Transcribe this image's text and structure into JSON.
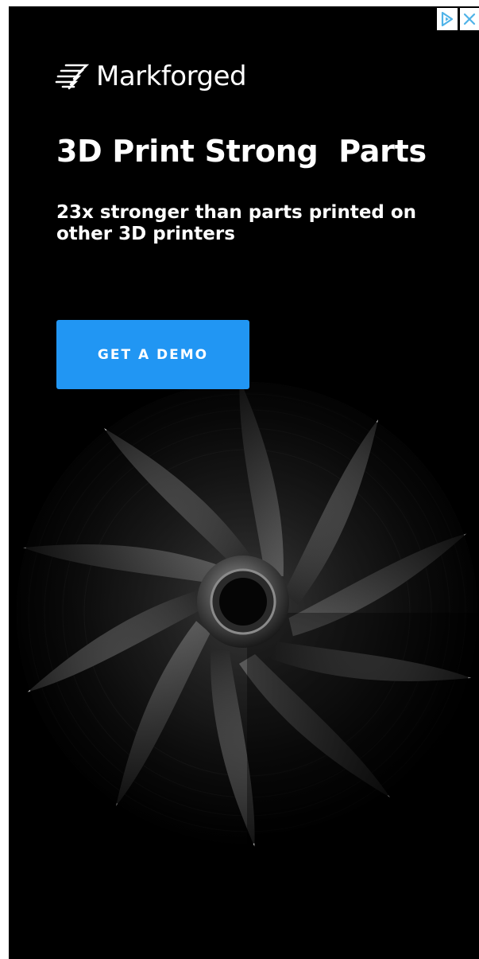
{
  "brand": {
    "name": "Markforged",
    "logo_icon": "markforged-stripes-icon"
  },
  "headline": "3D Print Strong  Parts",
  "subheadline": "23x stronger than parts printed on other 3D printers",
  "cta": {
    "label": "GET A DEMO"
  },
  "ad_controls": {
    "adchoices_icon": "adchoices-icon",
    "close_icon": "close-icon"
  },
  "colors": {
    "background": "#000000",
    "cta": "#2196f3",
    "adchoices": "#4fb3e8"
  },
  "image": {
    "subject": "impeller-image"
  }
}
